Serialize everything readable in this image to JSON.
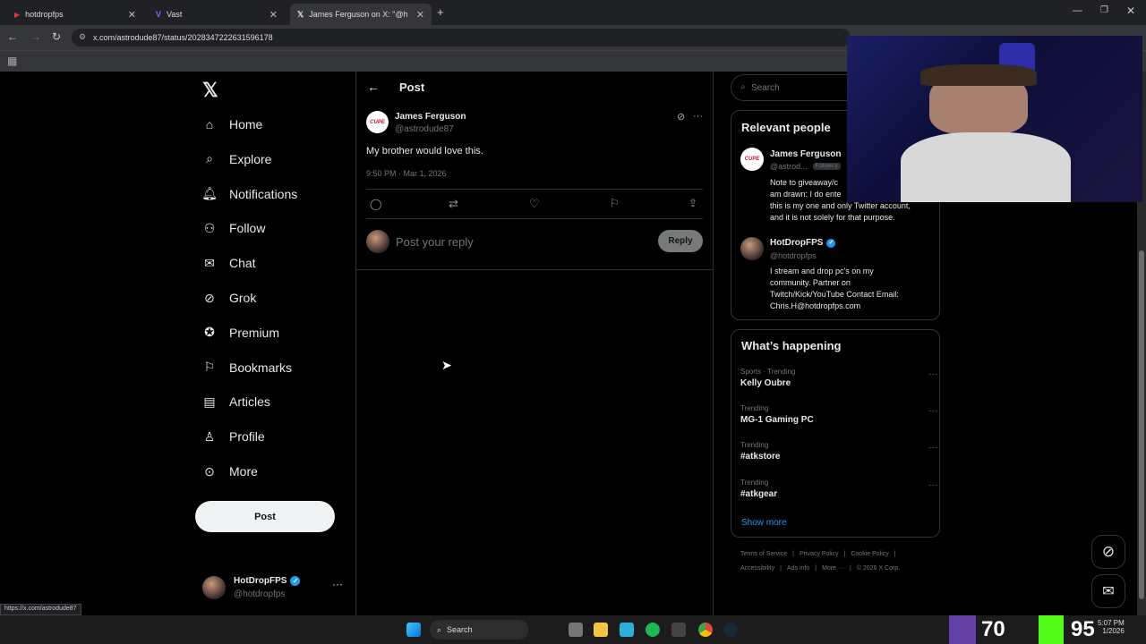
{
  "browser": {
    "tabs": [
      {
        "title": "hotdropfps"
      },
      {
        "title": "Vast"
      },
      {
        "title": "James Ferguson on X: \"@hotdro"
      }
    ],
    "url": "x.com/astrodude87/status/2028347222631596178",
    "status_url": "https://x.com/astrodude87"
  },
  "nav": {
    "items": [
      {
        "label": "Home",
        "icon": "home-icon"
      },
      {
        "label": "Explore",
        "icon": "search-icon"
      },
      {
        "label": "Notifications",
        "icon": "bell-icon"
      },
      {
        "label": "Follow",
        "icon": "person-add-icon"
      },
      {
        "label": "Chat",
        "icon": "mail-icon"
      },
      {
        "label": "Grok",
        "icon": "grok-icon"
      },
      {
        "label": "Premium",
        "icon": "premium-icon"
      },
      {
        "label": "Bookmarks",
        "icon": "bookmark-icon"
      },
      {
        "label": "Articles",
        "icon": "article-icon"
      },
      {
        "label": "Profile",
        "icon": "person-icon"
      },
      {
        "label": "More",
        "icon": "more-circle-icon"
      }
    ],
    "post_label": "Post",
    "account": {
      "name": "HotDropFPS",
      "handle": "@hotdropfps"
    }
  },
  "post": {
    "header": "Post",
    "author_name": "James Ferguson",
    "author_handle": "@astrodude87",
    "avatar_text": "CUPE",
    "text": "My brother would love this.",
    "timestamp": "9:50 PM · Mar 1, 2026",
    "reply_placeholder": "Post your reply",
    "reply_button": "Reply"
  },
  "sidebar": {
    "search_placeholder": "Search",
    "relevant_title": "Relevant people",
    "people": [
      {
        "name": "James Ferguson",
        "handle": "@astrod...",
        "follows_badge": "Follows y",
        "bio_lines": [
          "Note to giveaway/c",
          "am drawn: I do ente",
          "this is my one and only Twitter account,",
          "and it is not solely for that purpose."
        ]
      },
      {
        "name": "HotDropFPS",
        "handle": "@hotdropfps",
        "bio_lines": [
          "I stream and drop pc's on my",
          "community. Partner on",
          "Twitch/Kick/YouTube Contact Email:",
          "Chris.H@hotdropfps.com"
        ]
      }
    ],
    "happening_title": "What’s happening",
    "trends": [
      {
        "category": "Sports · Trending",
        "name": "Kelly Oubre"
      },
      {
        "category": "Trending",
        "name": "MG-1 Gaming PC"
      },
      {
        "category": "Trending",
        "name": "#atkstore"
      },
      {
        "category": "Trending",
        "name": "#atkgear"
      }
    ],
    "show_more": "Show more",
    "footer_row1": [
      "Terms of Service",
      "Privacy Policy",
      "Cookie Policy"
    ],
    "footer_row2": [
      "Accessibility",
      "Ads info",
      "More ···",
      "© 2026 X Corp."
    ]
  },
  "taskbar": {
    "search_label": "Search",
    "widget_70": "70",
    "widget_95": "95",
    "time": "5:07 PM",
    "date": "1/2026"
  },
  "colors": {
    "accent": "#1d9bf0",
    "bg": "#000000",
    "border": "#2f3336",
    "muted": "#71767b"
  }
}
